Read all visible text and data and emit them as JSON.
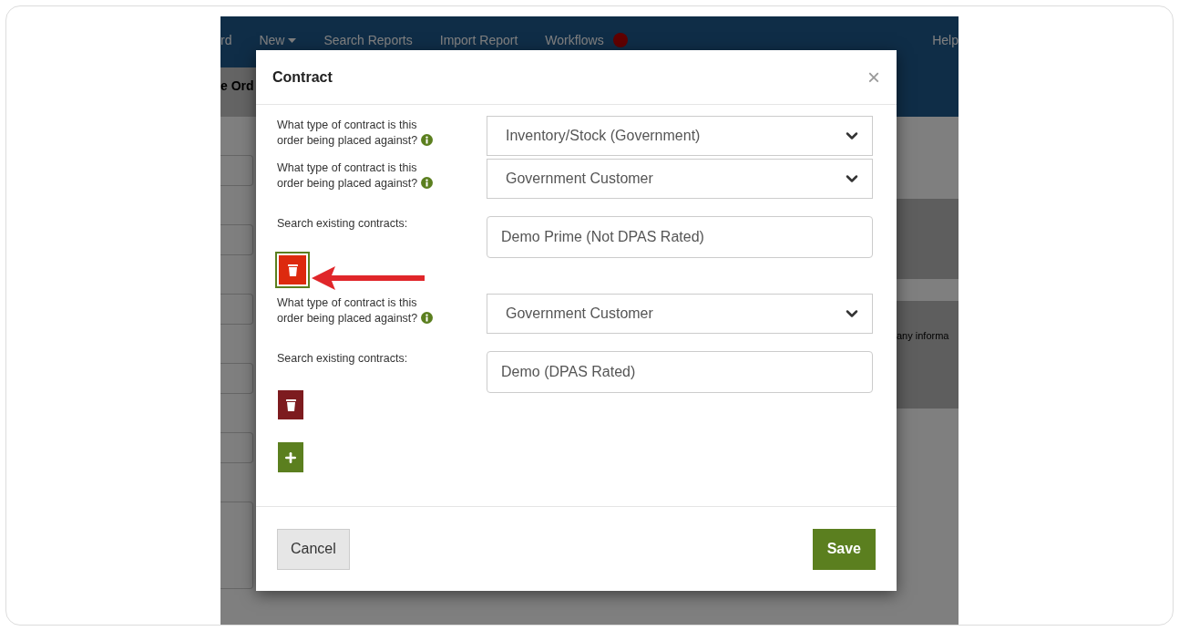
{
  "navbar": {
    "items": [
      {
        "label": "rd",
        "has_menu": false,
        "badge": false
      },
      {
        "label": "New",
        "has_menu": true,
        "badge": false
      },
      {
        "label": "Search Reports",
        "has_menu": false,
        "badge": false
      },
      {
        "label": "Import Report",
        "has_menu": false,
        "badge": false
      },
      {
        "label": "Workflows",
        "has_menu": false,
        "badge": true
      }
    ],
    "help": "Help"
  },
  "subbar": {
    "tab": "e Ord"
  },
  "background": {
    "note": "any informa"
  },
  "modal": {
    "title": "Contract",
    "close": "×",
    "rows": [
      {
        "kind": "select",
        "label": "What type of contract is this order being placed against?",
        "value": "Inventory/Stock (Government)"
      },
      {
        "kind": "select",
        "label": "What type of contract is this order being placed against?",
        "value": "Government Customer"
      },
      {
        "kind": "search",
        "label": "Search existing contracts:",
        "value": "Demo Prime (Not DPAS Rated)"
      },
      {
        "kind": "delete",
        "highlighted": true
      },
      {
        "kind": "select",
        "label": "What type of contract is this order being placed against?",
        "value": "Government Customer"
      },
      {
        "kind": "search",
        "label": "Search existing contracts:",
        "value": "Demo (DPAS Rated)"
      },
      {
        "kind": "delete",
        "highlighted": false
      },
      {
        "kind": "add"
      }
    ],
    "cancel": "Cancel",
    "save": "Save"
  }
}
